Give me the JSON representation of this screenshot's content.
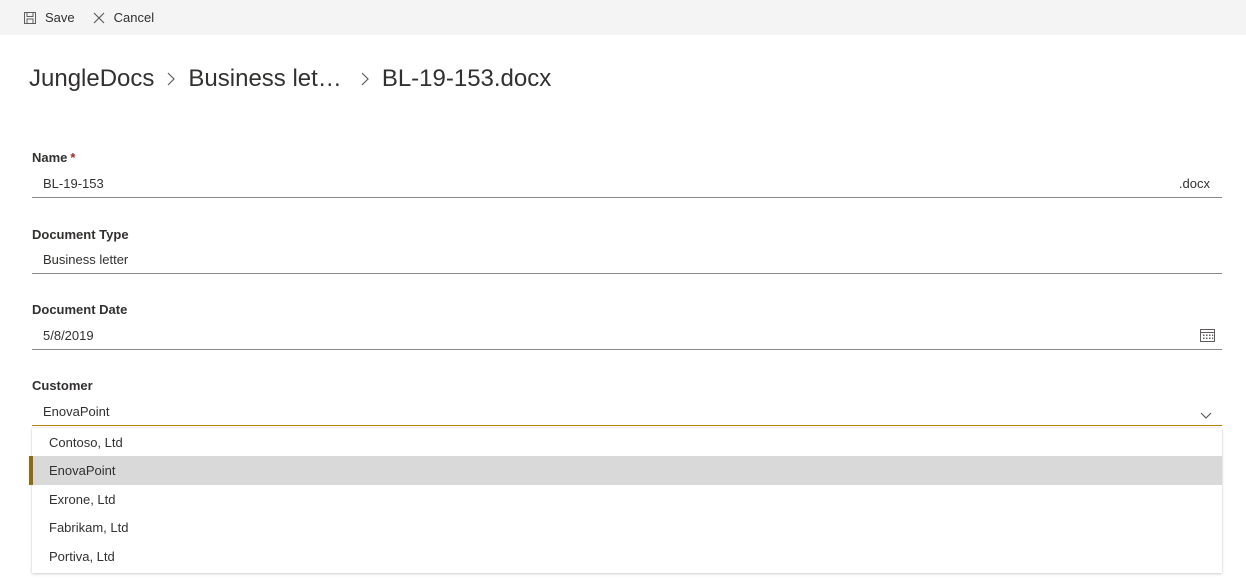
{
  "toolbar": {
    "save_label": "Save",
    "cancel_label": "Cancel"
  },
  "breadcrumb": {
    "root": "JungleDocs",
    "folder": "Business let…",
    "file": "BL-19-153.docx"
  },
  "form": {
    "name": {
      "label": "Name",
      "required_mark": "*",
      "value": "BL-19-153",
      "suffix": ".docx"
    },
    "document_type": {
      "label": "Document Type",
      "value": "Business letter"
    },
    "document_date": {
      "label": "Document Date",
      "value": "5/8/2019"
    },
    "customer": {
      "label": "Customer",
      "value": "EnovaPoint",
      "options": [
        "Contoso, Ltd",
        "EnovaPoint",
        "Exrone, Ltd",
        "Fabrikam, Ltd",
        "Portiva, Ltd"
      ],
      "selected_index": 1
    }
  },
  "colors": {
    "accent": "#8e6b0b",
    "focus_underline": "#b5850b",
    "required": "#a4262c",
    "selected_bg": "#d9d9d9"
  }
}
